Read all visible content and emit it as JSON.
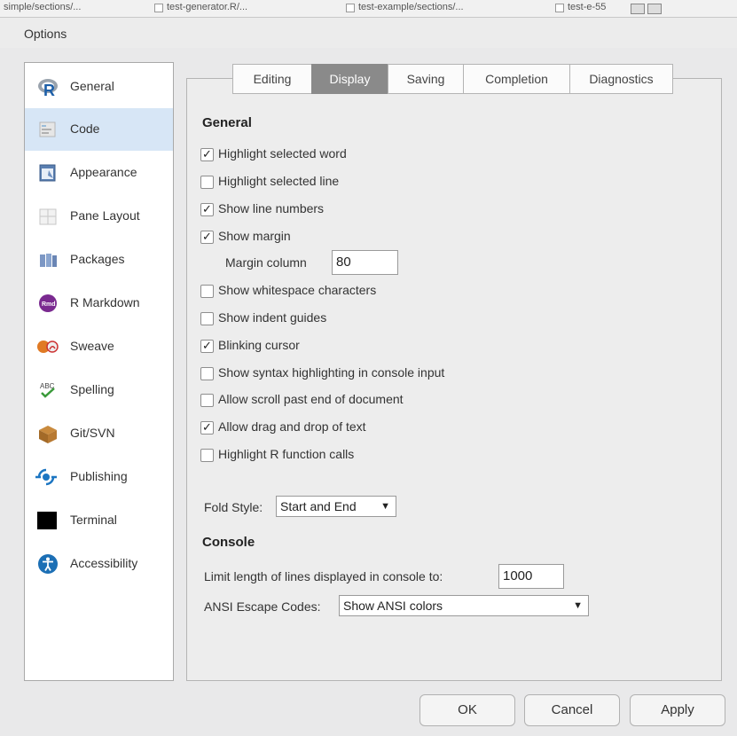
{
  "window": {
    "title": "Options"
  },
  "background_tabs": [
    "simple/sections/...",
    "test-generator.R/...",
    "test-example/sections/...",
    "test-e-55"
  ],
  "sidebar": {
    "selected": "Code",
    "items": [
      {
        "label": "General",
        "icon": "r-logo-icon"
      },
      {
        "label": "Code",
        "icon": "code-icon"
      },
      {
        "label": "Appearance",
        "icon": "appearance-icon"
      },
      {
        "label": "Pane Layout",
        "icon": "pane-layout-icon"
      },
      {
        "label": "Packages",
        "icon": "packages-icon"
      },
      {
        "label": "R Markdown",
        "icon": "rmarkdown-icon"
      },
      {
        "label": "Sweave",
        "icon": "sweave-icon"
      },
      {
        "label": "Spelling",
        "icon": "spelling-icon"
      },
      {
        "label": "Git/SVN",
        "icon": "git-svn-icon"
      },
      {
        "label": "Publishing",
        "icon": "publishing-icon"
      },
      {
        "label": "Terminal",
        "icon": "terminal-icon"
      },
      {
        "label": "Accessibility",
        "icon": "accessibility-icon"
      }
    ]
  },
  "tabs": {
    "active": "Display",
    "items": [
      "Editing",
      "Display",
      "Saving",
      "Completion",
      "Diagnostics"
    ]
  },
  "general": {
    "heading": "General",
    "options": [
      {
        "label": "Highlight selected word",
        "checked": true
      },
      {
        "label": "Highlight selected line",
        "checked": false
      },
      {
        "label": "Show line numbers",
        "checked": true
      },
      {
        "label": "Show margin",
        "checked": true
      },
      {
        "label": "Show whitespace characters",
        "checked": false
      },
      {
        "label": "Show indent guides",
        "checked": false
      },
      {
        "label": "Blinking cursor",
        "checked": true
      },
      {
        "label": "Show syntax highlighting in console input",
        "checked": false
      },
      {
        "label": "Allow scroll past end of document",
        "checked": false
      },
      {
        "label": "Allow drag and drop of text",
        "checked": true
      },
      {
        "label": "Highlight R function calls",
        "checked": false
      }
    ],
    "margin_column_label": "Margin column",
    "margin_column_value": "80",
    "fold_style_label": "Fold Style:",
    "fold_style_value": "Start and End"
  },
  "console": {
    "heading": "Console",
    "limit_label": "Limit length of lines displayed in console to:",
    "limit_value": "1000",
    "ansi_label": "ANSI Escape Codes:",
    "ansi_value": "Show ANSI colors"
  },
  "buttons": {
    "ok": "OK",
    "cancel": "Cancel",
    "apply": "Apply"
  },
  "colors": {
    "selected_bg": "#d7e6f6",
    "active_tab": "#8a8a8a",
    "rmarkdown": "#7a2a90",
    "accessibility": "#1c6fb5",
    "publishing": "#1d76c2"
  }
}
